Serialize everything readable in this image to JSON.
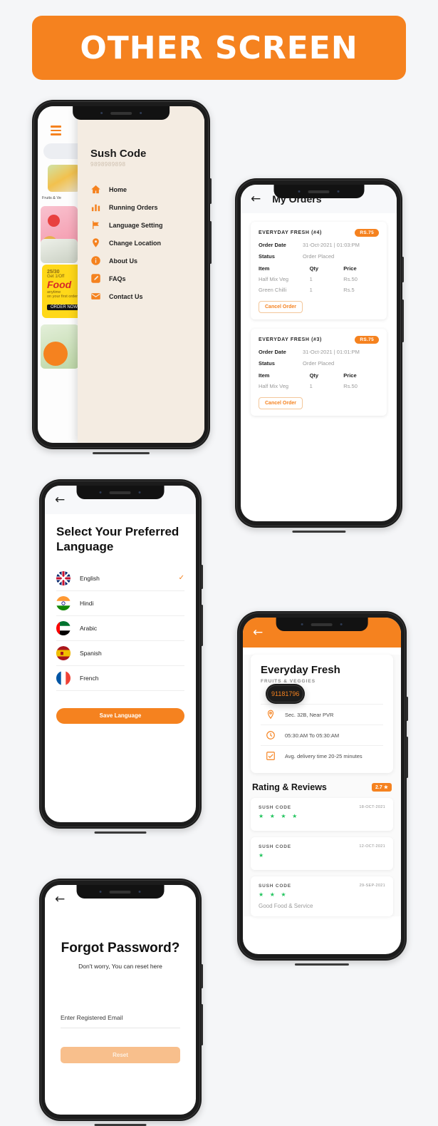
{
  "banner": {
    "text": "OTHER SCREEN"
  },
  "colors": {
    "accent": "#f5821f",
    "drawer_bg": "#f4ece2",
    "page_bg": "#f5f6f8",
    "star_green": "#22c55e"
  },
  "phone1": {
    "background": {
      "menu_icon": "hamburger-icon",
      "category_label": "Fruits & Ve",
      "promo": {
        "line1": "25/30",
        "line2": "Get 1/Off",
        "line3": "Food",
        "line4": "anytime",
        "line5": "on your first order",
        "button": "ORDER NOW"
      }
    },
    "drawer": {
      "user_name": "Sush Code",
      "user_phone": "9898989898",
      "items": [
        {
          "label": "Home",
          "icon": "home-icon"
        },
        {
          "label": "Running Orders",
          "icon": "bar-chart-icon"
        },
        {
          "label": "Language Setting",
          "icon": "flag-icon"
        },
        {
          "label": "Change Location",
          "icon": "map-pin-icon"
        },
        {
          "label": "About Us",
          "icon": "info-icon"
        },
        {
          "label": "FAQs",
          "icon": "edit-icon"
        },
        {
          "label": "Contact Us",
          "icon": "mail-icon"
        }
      ]
    }
  },
  "phone2": {
    "header": {
      "title": "My Orders",
      "back_icon": "back-arrow-icon"
    },
    "columns": {
      "item": "Item",
      "qty": "Qty",
      "price": "Price"
    },
    "labels": {
      "order_date": "Order Date",
      "status": "Status"
    },
    "cancel_label": "Cancel Order",
    "orders": [
      {
        "shop": "EVERYDAY FRESH (#4)",
        "amount": "RS.75",
        "order_date": "31-Oct-2021 | 01:03:PM",
        "status": "Order Placed",
        "items": [
          {
            "name": "Half Mix Veg",
            "qty": "1",
            "price": "Rs.50"
          },
          {
            "name": "Green Chilli",
            "qty": "1",
            "price": "Rs.5"
          }
        ]
      },
      {
        "shop": "EVERYDAY FRESH (#3)",
        "amount": "RS.75",
        "order_date": "31-Oct-2021 | 01:01:PM",
        "status": "Order Placed",
        "items": [
          {
            "name": "Half Mix Veg",
            "qty": "1",
            "price": "Rs.50"
          }
        ]
      }
    ]
  },
  "phone3": {
    "back_icon": "back-arrow-icon",
    "title": "Select Your Preferred Language",
    "languages": [
      {
        "label": "English",
        "flag": "flag-uk",
        "selected": true
      },
      {
        "label": "Hindi",
        "flag": "flag-india",
        "selected": false
      },
      {
        "label": "Arabic",
        "flag": "flag-uae",
        "selected": false
      },
      {
        "label": "Spanish",
        "flag": "flag-spain",
        "selected": false
      },
      {
        "label": "French",
        "flag": "flag-france",
        "selected": false
      }
    ],
    "check_glyph": "✓",
    "save_label": "Save Language"
  },
  "phone4": {
    "back_icon": "back-arrow-icon",
    "restaurant": {
      "name": "Everyday Fresh",
      "category": "FRUITS & VEGGIES",
      "phone": "91181796",
      "address": "Sec. 32B, Near PVR",
      "hours": "05:30:AM To 05:30:AM",
      "delivery": "Avg. delivery time 20-25 minutes"
    },
    "reviews_title": "Rating & Reviews",
    "rating_badge": "2.7 ★",
    "reviews": [
      {
        "user": "SUSH CODE",
        "date": "18-OCT-2021",
        "stars": "★ ★ ★ ★",
        "text": ""
      },
      {
        "user": "SUSH CODE",
        "date": "12-OCT-2021",
        "stars": "★",
        "text": ""
      },
      {
        "user": "SUSH CODE",
        "date": "29-SEP-2021",
        "stars": "★ ★ ★",
        "text": "Good Food & Service"
      }
    ]
  },
  "phone5": {
    "back_icon": "back-arrow-icon",
    "title": "Forgot Password?",
    "subtitle": "Don't worry, You can reset here",
    "email_placeholder": "Enter Registered Email",
    "reset_label": "Reset"
  }
}
